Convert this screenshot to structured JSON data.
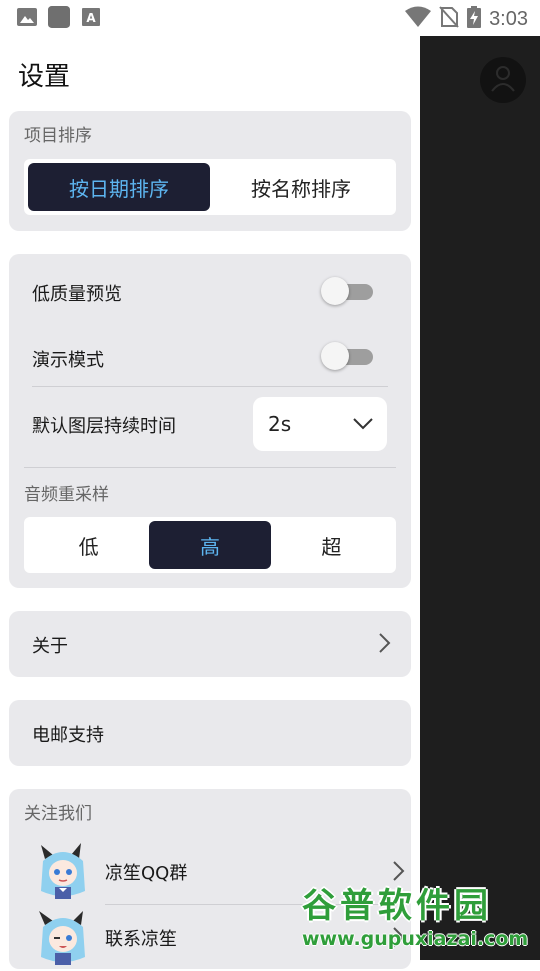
{
  "status_bar": {
    "time": "3:03",
    "icons": [
      "gallery-icon",
      "app-square-icon",
      "font-icon",
      "wifi-icon",
      "no-sim-icon",
      "battery-charging-icon"
    ]
  },
  "drawer": {
    "title": "设置",
    "sort": {
      "label": "项目排序",
      "options": [
        "按日期排序",
        "按名称排序"
      ],
      "selected": "按日期排序"
    },
    "settings": {
      "low_quality_preview": {
        "label": "低质量预览",
        "on": false
      },
      "demo_mode": {
        "label": "演示模式",
        "on": false
      },
      "layer_duration": {
        "label": "默认图层持续时间",
        "value": "2s"
      },
      "resample": {
        "label": "音频重采样",
        "options": [
          "低",
          "高",
          "超"
        ],
        "selected": "高"
      }
    },
    "about": {
      "label": "关于"
    },
    "email": {
      "label": "电邮支持"
    },
    "follow": {
      "label": "关注我们",
      "items": [
        {
          "name": "凉笙QQ群"
        },
        {
          "name": "联系凉笙"
        }
      ]
    }
  },
  "watermark": {
    "title": "谷普软件园",
    "url": "www.gupuxiazai.com"
  },
  "colors": {
    "accent_bg": "#1d1f33",
    "accent_text": "#5db5f0",
    "card_bg": "#e9e9ec",
    "overlay": "#1e1e1e",
    "watermark": "#2f9e3a"
  }
}
